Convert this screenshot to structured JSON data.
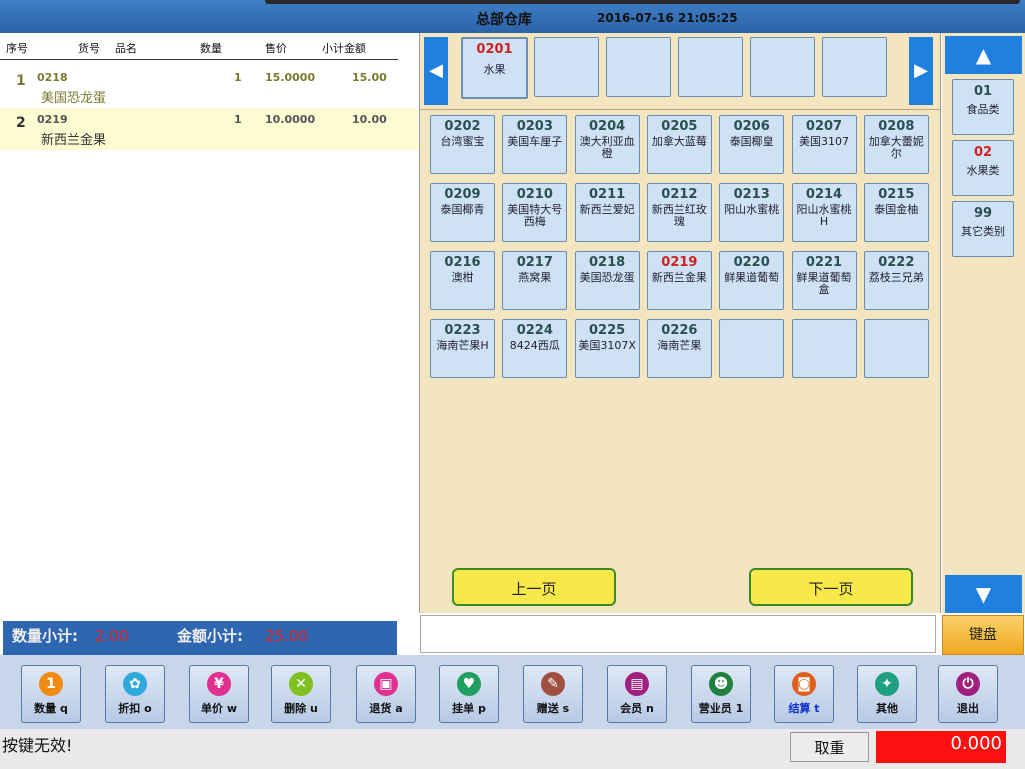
{
  "header": {
    "title": "总部仓库",
    "datetime": "2016-07-16 21:05:25"
  },
  "list": {
    "columns": {
      "seq": "序号",
      "code": "货号",
      "name": "品名",
      "qty": "数量",
      "price": "售价",
      "subtotal": "小计金额"
    },
    "rows": [
      {
        "seq": "1",
        "code": "0218",
        "name": "美国恐龙蛋",
        "qty": "1",
        "price": "15.0000",
        "subtotal": "15.00"
      },
      {
        "seq": "2",
        "code": "0219",
        "name": "新西兰金果",
        "qty": "1",
        "price": "10.0000",
        "subtotal": "10.00"
      }
    ]
  },
  "summary": {
    "qty_label": "数量小计:",
    "qty_value": "2.00",
    "amount_label": "金额小计:",
    "amount_value": "25.00"
  },
  "subcategories": [
    {
      "code": "0201",
      "name": "水果"
    }
  ],
  "products": [
    {
      "code": "0202",
      "name": "台湾蜜宝"
    },
    {
      "code": "0203",
      "name": "美国车厘子"
    },
    {
      "code": "0204",
      "name": "澳大利亚血橙"
    },
    {
      "code": "0205",
      "name": "加拿大蓝莓"
    },
    {
      "code": "0206",
      "name": "泰国椰皇"
    },
    {
      "code": "0207",
      "name": "美国3107"
    },
    {
      "code": "0208",
      "name": "加拿大蕾妮尔"
    },
    {
      "code": "0209",
      "name": "泰国椰青"
    },
    {
      "code": "0210",
      "name": "美国特大号西梅"
    },
    {
      "code": "0211",
      "name": "新西兰爱妃"
    },
    {
      "code": "0212",
      "name": "新西兰红玫瑰"
    },
    {
      "code": "0213",
      "name": "阳山水蜜桃"
    },
    {
      "code": "0214",
      "name": "阳山水蜜桃H"
    },
    {
      "code": "0215",
      "name": "泰国金柚"
    },
    {
      "code": "0216",
      "name": "澳柑"
    },
    {
      "code": "0217",
      "name": "燕窝果"
    },
    {
      "code": "0218",
      "name": "美国恐龙蛋"
    },
    {
      "code": "0219",
      "name": "新西兰金果"
    },
    {
      "code": "0220",
      "name": "鲜果道葡萄"
    },
    {
      "code": "0221",
      "name": "鲜果道葡萄盒"
    },
    {
      "code": "0222",
      "name": "荔枝三兄弟"
    },
    {
      "code": "0223",
      "name": "海南芒果H"
    },
    {
      "code": "0224",
      "name": "8424西瓜"
    },
    {
      "code": "0225",
      "name": "美国3107X"
    },
    {
      "code": "0226",
      "name": "海南芒果"
    }
  ],
  "selected_product": "0219",
  "pager": {
    "prev": "上一页",
    "next": "下一页"
  },
  "categories": [
    {
      "code": "01",
      "name": "食品类"
    },
    {
      "code": "02",
      "name": "水果类"
    },
    {
      "code": "99",
      "name": "其它类别"
    }
  ],
  "selected_category": "02",
  "keyboard_label": "键盘",
  "toolbar": [
    {
      "label": "数量 q",
      "icon": "number-one-icon",
      "glyph": "1",
      "color": "#f08a10"
    },
    {
      "label": "折扣 o",
      "icon": "discount-icon",
      "glyph": "✿",
      "color": "#30a8d8"
    },
    {
      "label": "单价 w",
      "icon": "yen-icon",
      "glyph": "¥",
      "color": "#e03090"
    },
    {
      "label": "删除 u",
      "icon": "delete-icon",
      "glyph": "✕",
      "color": "#80c020"
    },
    {
      "label": "退货 a",
      "icon": "return-box-icon",
      "glyph": "▣",
      "color": "#e03090"
    },
    {
      "label": "挂单 p",
      "icon": "hold-heart-icon",
      "glyph": "♥",
      "color": "#20a060"
    },
    {
      "label": "赠送 s",
      "icon": "gift-note-icon",
      "glyph": "✎",
      "color": "#a05040"
    },
    {
      "label": "会员 n",
      "icon": "member-card-icon",
      "glyph": "▤",
      "color": "#a02080"
    },
    {
      "label": "营业员 1",
      "icon": "cashier-user-icon",
      "glyph": "☻",
      "color": "#208040"
    },
    {
      "label": "结算 t",
      "icon": "checkout-icon",
      "glyph": "◙",
      "color": "#e06020"
    },
    {
      "label": "其他",
      "icon": "other-icon",
      "glyph": "✦",
      "color": "#20a080"
    },
    {
      "label": "退出",
      "icon": "power-icon",
      "glyph": "⏻",
      "color": "#a02080"
    }
  ],
  "status": {
    "message": "按键无效!",
    "cancel_label": "取重",
    "total": "0.000"
  },
  "colors": {
    "header": "#2c63a8",
    "panel": "#f3e5bf",
    "tile": "#cfe1f5",
    "total_bg": "#ff1010",
    "summary_value": "#e02020"
  }
}
